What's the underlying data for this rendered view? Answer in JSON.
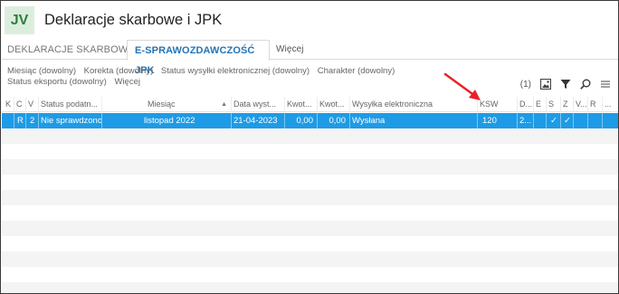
{
  "app": {
    "badge": "JV",
    "title": "Deklaracje skarbowe i JPK"
  },
  "tabs": [
    {
      "label": "DEKLARACJE SKARBOWE"
    },
    {
      "label": "E-SPRAWOZDAWCZOŚĆ JPK"
    },
    {
      "label": "Więcej"
    }
  ],
  "filters": {
    "line1": [
      "Miesiąc (dowolny)",
      "Korekta (dowolny)",
      "Status wysyłki elektronicznej (dowolny)",
      "Charakter (dowolny)"
    ],
    "line2": [
      "Status eksportu (dowolny)",
      "Więcej"
    ]
  },
  "toolbar": {
    "count": "(1)",
    "icons": [
      "image-icon",
      "filter-icon",
      "search-icon",
      "menu-icon"
    ]
  },
  "columns": [
    "K",
    "C",
    "V",
    "Status podatn...",
    "Miesiąc",
    "Data wyst...",
    "Kwot...",
    "Kwot...",
    "Wysyłka elektroniczna",
    "KSW",
    "D...",
    "E",
    "S",
    "Z",
    "V...",
    "R",
    "..."
  ],
  "row": {
    "k": "",
    "c": "R",
    "v": "2",
    "status": "Nie sprawdzono",
    "miesiac": "listopad 2022",
    "data": "21-04-2023",
    "kwota1": "0,00",
    "kwota2": "0,00",
    "wysylka": "Wysłana",
    "ksw": "120",
    "d": "2...",
    "e": "",
    "s": "✓",
    "z": "✓",
    "v2": "",
    "r": ""
  },
  "colors": {
    "selected_row": "#1e9be6",
    "active_tab": "#2474b5",
    "badge_bg": "#dbeedd",
    "badge_fg": "#2f7d3a",
    "arrow": "#e8202a"
  }
}
